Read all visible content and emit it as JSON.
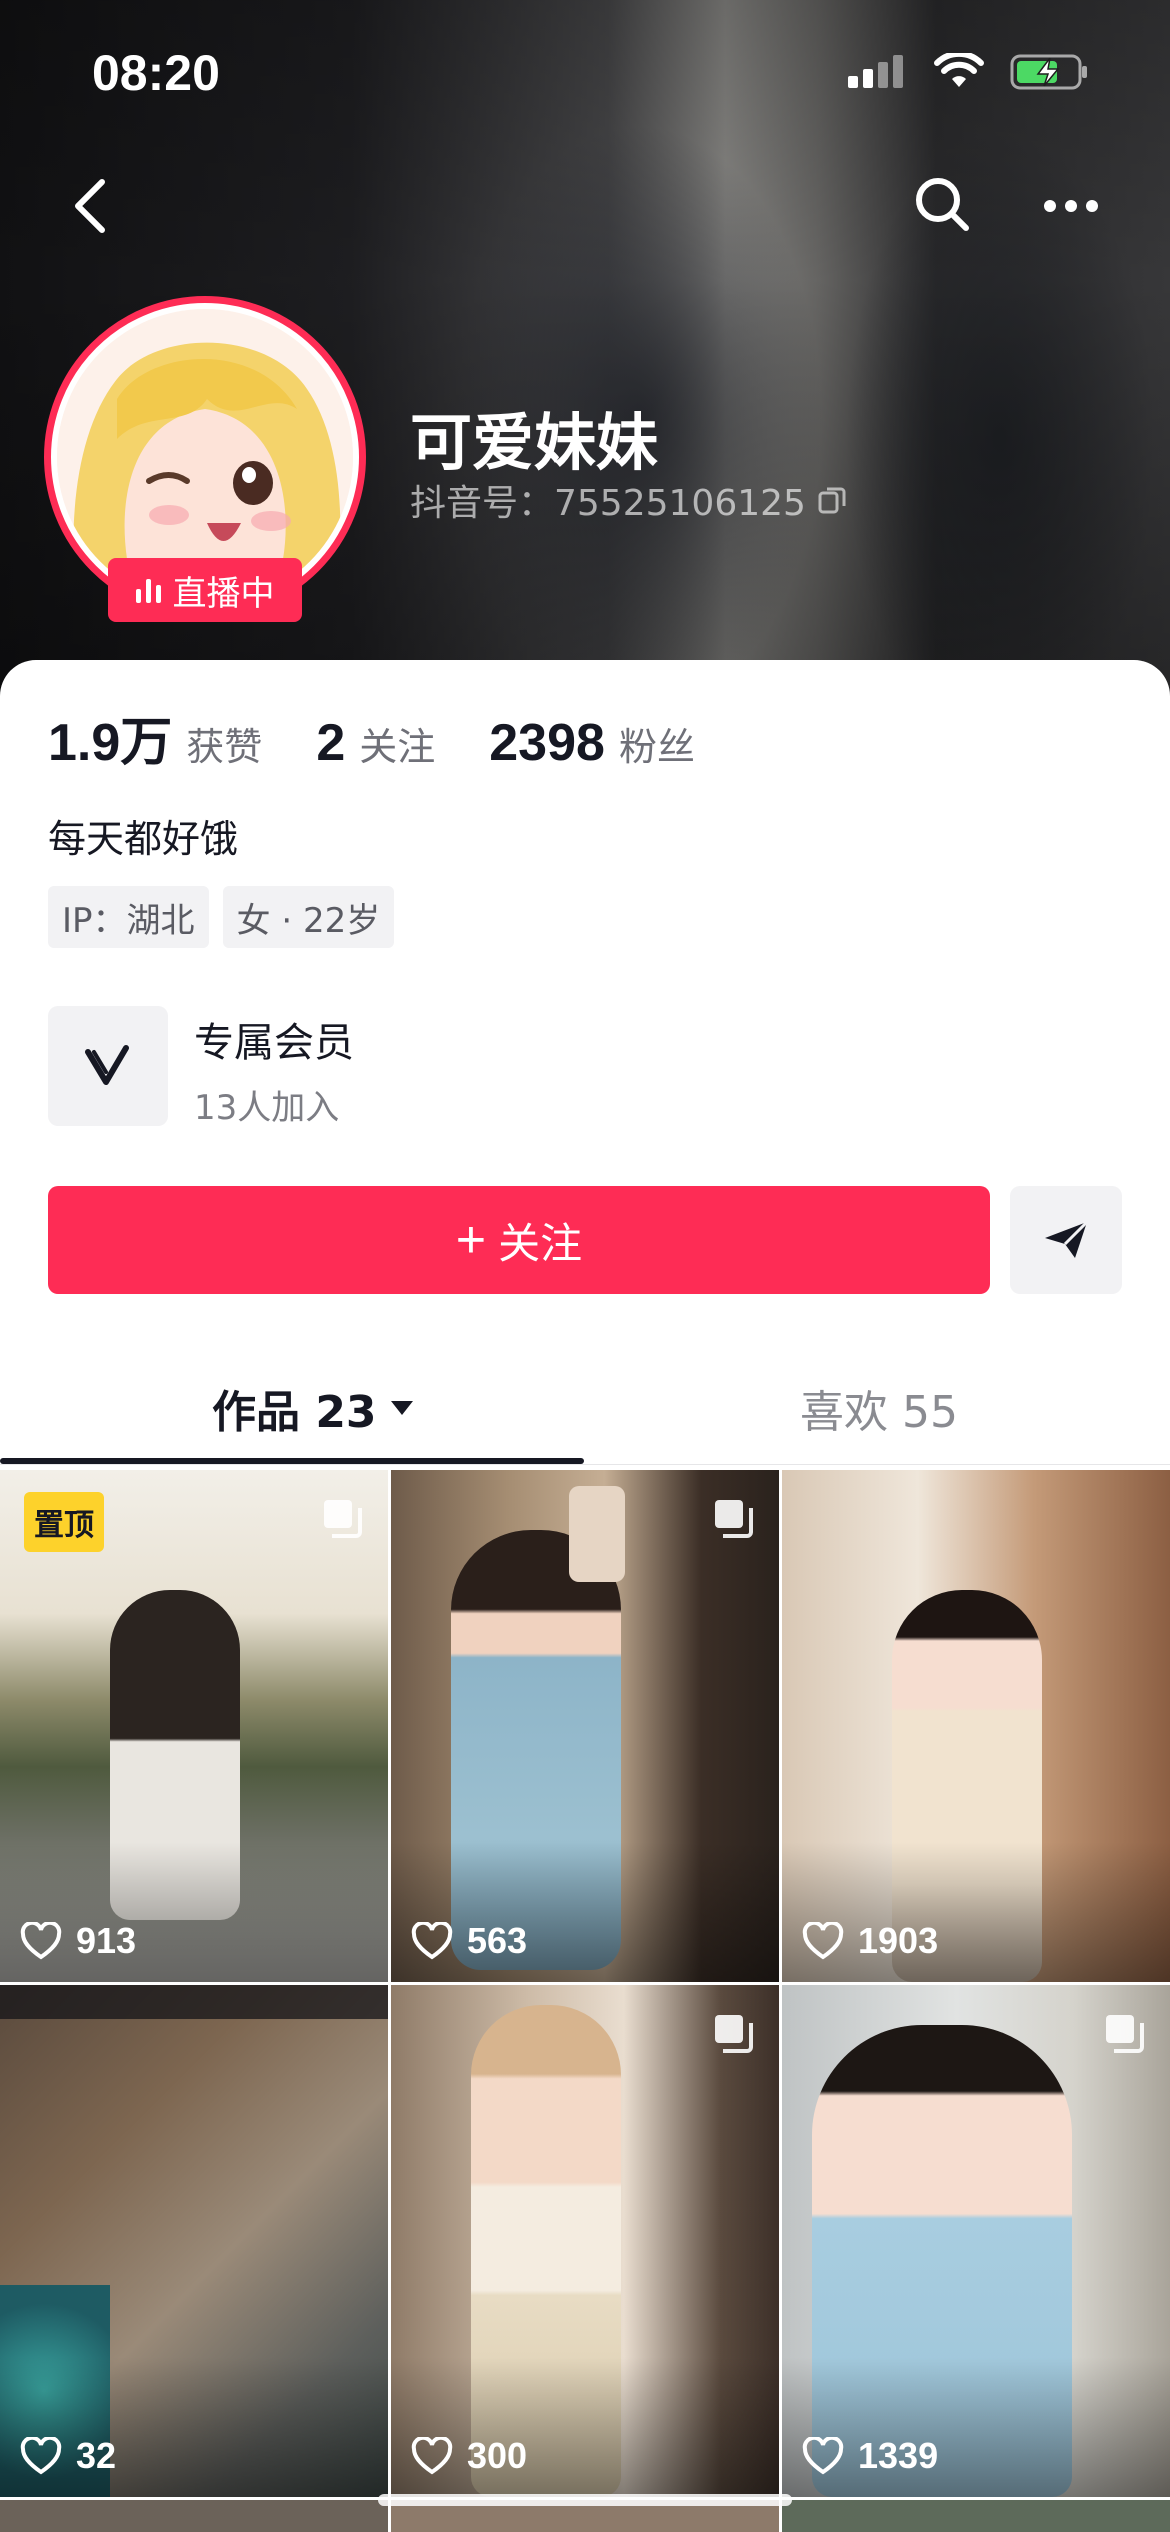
{
  "status_bar": {
    "time": "08:20"
  },
  "profile": {
    "nickname": "可爱妹妹",
    "douyin_id": "抖音号：75525106125",
    "live_badge": "直播中",
    "bio": "每天都好饿",
    "tags": [
      "IP：湖北",
      "女 · 22岁"
    ]
  },
  "stats": [
    {
      "value": "1.9万",
      "label": "获赞"
    },
    {
      "value": "2",
      "label": "关注"
    },
    {
      "value": "2398",
      "label": "粉丝"
    }
  ],
  "membership": {
    "title": "专属会员",
    "subtitle": "13人加入"
  },
  "actions": {
    "follow_label": "关注"
  },
  "tabs": {
    "works": "作品 23",
    "likes": "喜欢 55"
  },
  "pinned_label": "置顶",
  "videos": [
    {
      "likes": "913",
      "pinned": true
    },
    {
      "likes": "563"
    },
    {
      "likes": "1903"
    },
    {
      "likes": "32"
    },
    {
      "likes": "300"
    },
    {
      "likes": "1339"
    }
  ],
  "colors": {
    "accent": "#fe2c55",
    "pin": "#fdd22b",
    "text": "#161823"
  }
}
